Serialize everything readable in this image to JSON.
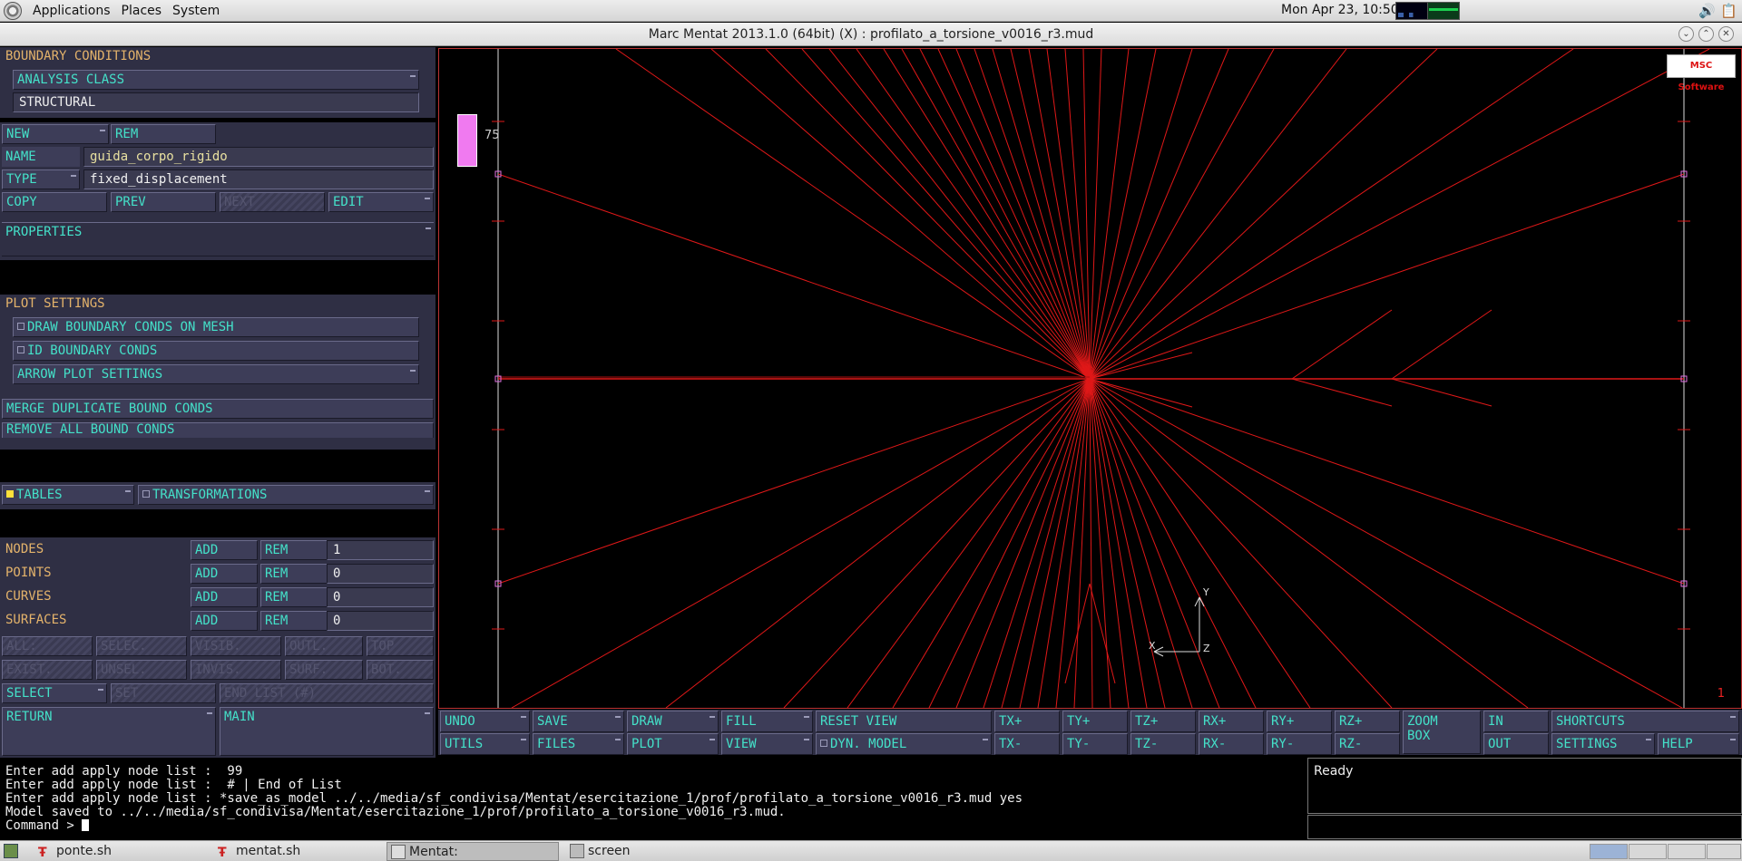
{
  "top_panel": {
    "menus": [
      "Applications",
      "Places",
      "System"
    ],
    "clock": "Mon Apr 23, 10:50"
  },
  "window": {
    "title": "Marc Mentat 2013.1.0 (64bit) (X) : profilato_a_torsione_v0016_r3.mud"
  },
  "left_panel": {
    "section_title": "BOUNDARY CONDITIONS",
    "analysis_class_btn": "ANALYSIS CLASS",
    "analysis_class_value": "STRUCTURAL",
    "new": "NEW",
    "rem": "REM",
    "name_label": "NAME",
    "name_value": "guida_corpo_rigido",
    "type_label": "TYPE",
    "type_value": "fixed_displacement",
    "copy": "COPY",
    "prev": "PREV",
    "next": "NEXT",
    "edit": "EDIT",
    "properties": "PROPERTIES",
    "plot_settings": "PLOT SETTINGS",
    "draw_bc": "DRAW BOUNDARY CONDS ON MESH",
    "id_bc": "ID BOUNDARY CONDS",
    "arrow_plot": "ARROW PLOT SETTINGS",
    "merge": "MERGE DUPLICATE BOUND CONDS",
    "remove_all": "REMOVE ALL BOUND CONDS",
    "tables": "TABLES",
    "transformations": "TRANSFORMATIONS",
    "entities": [
      {
        "label": "NODES",
        "add": "ADD",
        "rem": "REM",
        "value": "1"
      },
      {
        "label": "POINTS",
        "add": "ADD",
        "rem": "REM",
        "value": "0"
      },
      {
        "label": "CURVES",
        "add": "ADD",
        "rem": "REM",
        "value": "0"
      },
      {
        "label": "SURFACES",
        "add": "ADD",
        "rem": "REM",
        "value": "0"
      }
    ],
    "sel_row1": [
      "ALL:",
      "SELEC.",
      "VISIB.",
      "OUTL.",
      "TOP"
    ],
    "sel_row2": [
      "EXIST.",
      "UNSEL.",
      "INVIS.",
      "SURF.",
      "BOT."
    ],
    "select": "SELECT",
    "set": "SET",
    "end_list": "END LIST (#)",
    "return": "RETURN",
    "main": "MAIN"
  },
  "viewport": {
    "legend_value": "75",
    "frame_number": "1",
    "logo": "MSC Software",
    "axis_x": "X",
    "axis_y": "Y",
    "axis_z": "Z"
  },
  "toolbar": {
    "undo": "UNDO",
    "save": "SAVE",
    "draw": "DRAW",
    "fill": "FILL",
    "reset_view": "RESET VIEW",
    "txp": "TX+",
    "typ": "TY+",
    "tzp": "TZ+",
    "rxp": "RX+",
    "ryp": "RY+",
    "rzp": "RZ+",
    "zoom": "ZOOM",
    "box": "BOX",
    "in": "IN",
    "shortcuts": "SHORTCUTS",
    "utils": "UTILS",
    "files": "FILES",
    "plot": "PLOT",
    "view": "VIEW",
    "dyn_model": "DYN. MODEL",
    "txm": "TX-",
    "tym": "TY-",
    "tzm": "TZ-",
    "rxm": "RX-",
    "rym": "RY-",
    "rzm": "RZ-",
    "out": "OUT",
    "settings": "SETTINGS",
    "help": "HELP"
  },
  "console": {
    "lines": [
      "Enter add apply node list :  99",
      "Enter add apply node list :  # | End of List",
      "Enter add apply node list : *save_as_model ../../media/sf_condivisa/Mentat/esercitazione_1/prof/profilato_a_torsione_v0016_r3.mud yes",
      "Model saved to ../../media/sf_condivisa/Mentat/esercitazione_1/prof/profilato_a_torsione_v0016_r3.mud."
    ],
    "prompt": "Command > "
  },
  "status": {
    "text": "Ready"
  },
  "taskbar": {
    "tasks": [
      "ponte.sh",
      "mentat.sh",
      "Mentat: profilato_a_to...",
      "screen"
    ]
  }
}
